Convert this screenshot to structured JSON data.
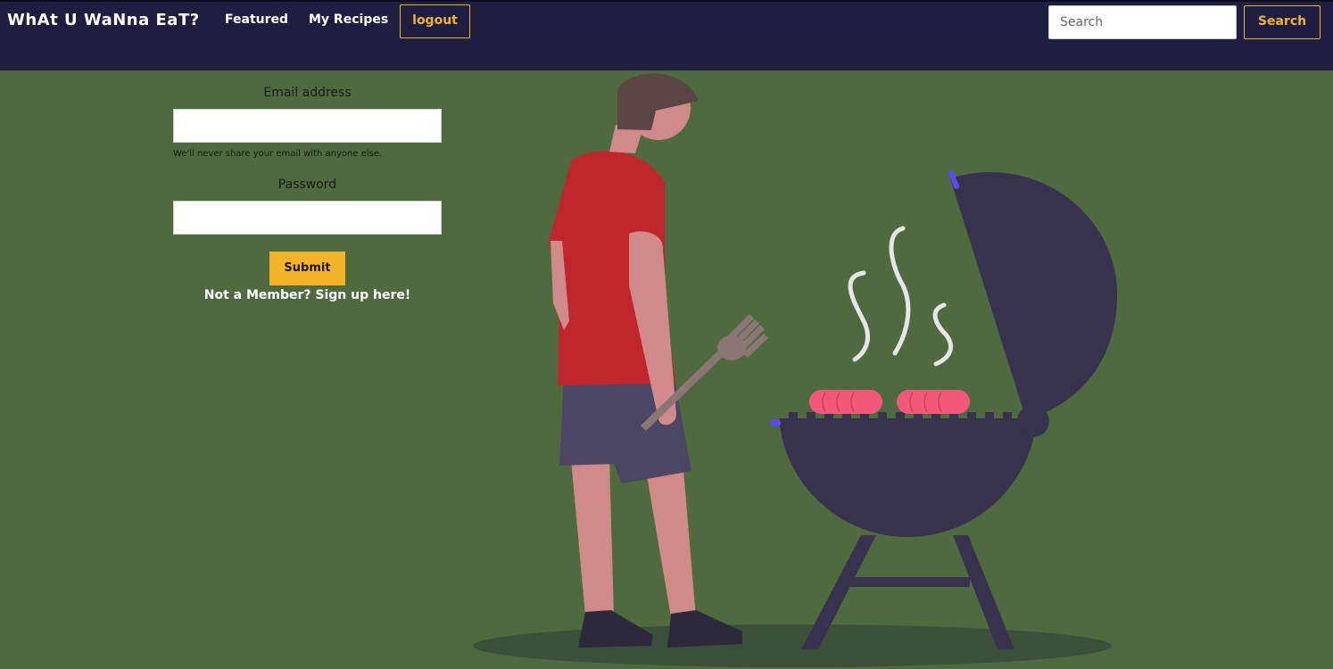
{
  "navbar": {
    "brand": "WhAt U WaNna EaT?",
    "links": [
      {
        "label": "Featured"
      },
      {
        "label": "My Recipes"
      }
    ],
    "logout_label": "logout",
    "search": {
      "placeholder": "Search",
      "button_label": "Search"
    }
  },
  "login": {
    "email_label": "Email address",
    "email_value": "",
    "email_help": "We'll never share your email with anyone else.",
    "password_label": "Password",
    "password_value": "",
    "submit_label": "Submit",
    "signup_text": "Not a Member? Sign up here!"
  },
  "colors": {
    "navbar": "#1f1d40",
    "background": "#4e6a3e",
    "accent": "#f0b52b",
    "grill": "#37334e",
    "shirt": "#c0272d",
    "sausage": "#f0597a"
  },
  "illustration": {
    "icon": "man-grilling-illustration"
  }
}
